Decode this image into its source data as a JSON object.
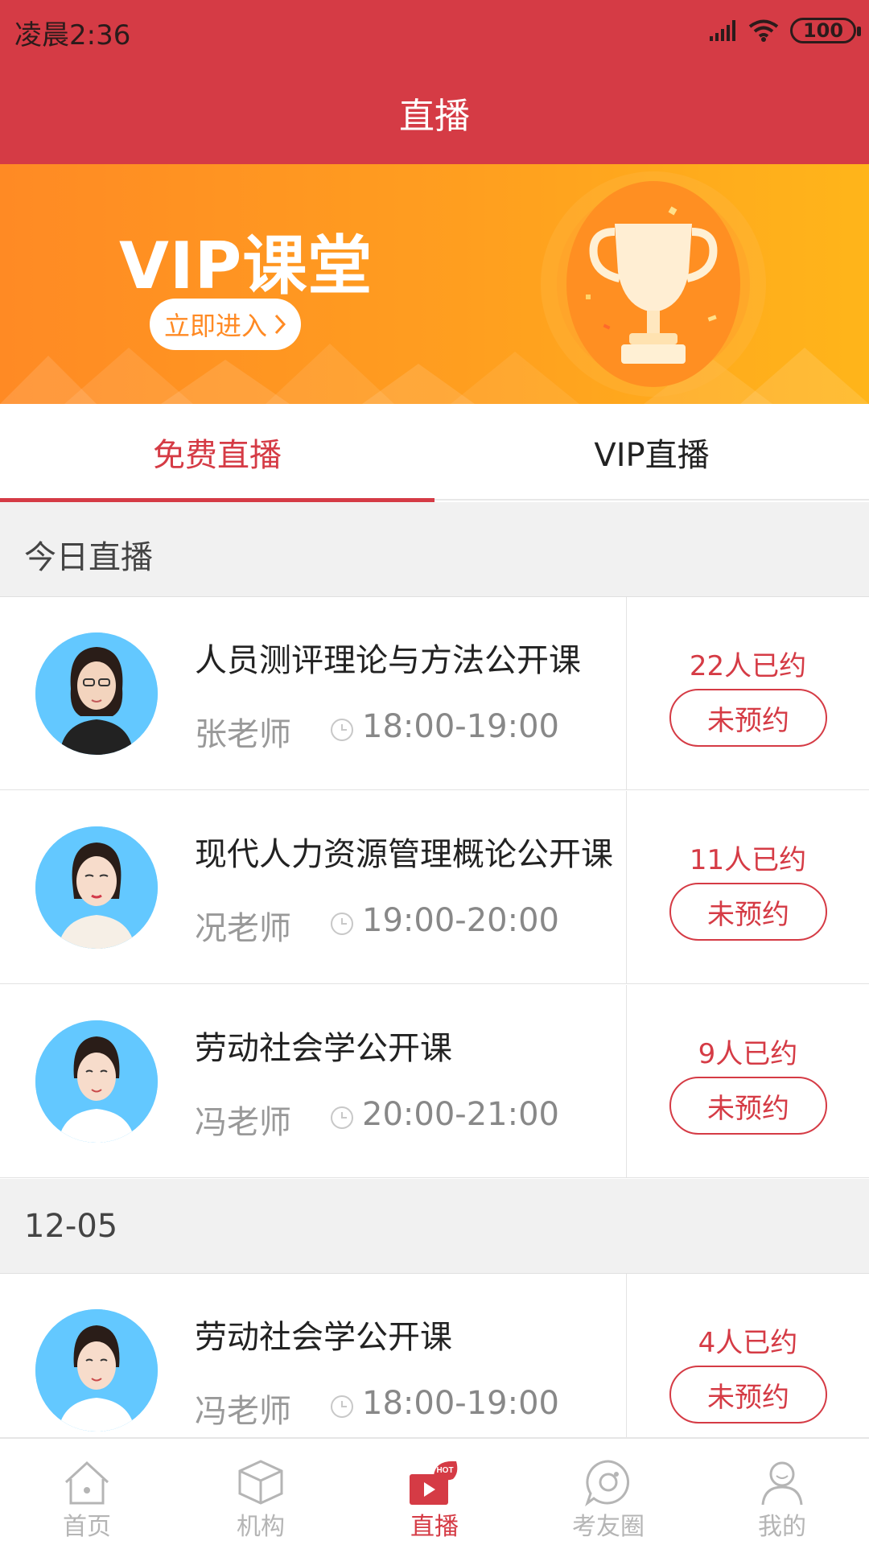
{
  "status_bar": {
    "time": "凌晨2:36",
    "battery": "100"
  },
  "header": {
    "title": "直播"
  },
  "banner": {
    "title": "VIP课堂",
    "button_label": "立即进入"
  },
  "tabs": [
    {
      "label": "免费直播",
      "active": true
    },
    {
      "label": "VIP直播",
      "active": false
    }
  ],
  "sections": [
    {
      "heading": "今日直播",
      "items": [
        {
          "course": "人员测评理论与方法公开课",
          "teacher": "张老师",
          "time": "18:00-19:00",
          "count": "22人已约",
          "button": "未预约"
        },
        {
          "course": "现代人力资源管理概论公开课",
          "teacher": "况老师",
          "time": "19:00-20:00",
          "count": "11人已约",
          "button": "未预约"
        },
        {
          "course": "劳动社会学公开课",
          "teacher": "冯老师",
          "time": "20:00-21:00",
          "count": "9人已约",
          "button": "未预约"
        }
      ]
    },
    {
      "heading": "12-05",
      "items": [
        {
          "course": "劳动社会学公开课",
          "teacher": "冯老师",
          "time": "18:00-19:00",
          "count": "4人已约",
          "button": "未预约"
        }
      ]
    }
  ],
  "bottom_nav": [
    {
      "label": "首页",
      "icon": "home-icon",
      "active": false
    },
    {
      "label": "机构",
      "icon": "cube-icon",
      "active": false
    },
    {
      "label": "直播",
      "icon": "live-hot-icon",
      "active": true,
      "badge": "HOT"
    },
    {
      "label": "考友圈",
      "icon": "chat-circle-icon",
      "active": false
    },
    {
      "label": "我的",
      "icon": "user-icon",
      "active": false
    }
  ],
  "colors": {
    "primary": "#d53b45",
    "banner_start": "#ff8a24",
    "banner_end": "#ffb51a",
    "avatar_bg": "#63c8ff"
  }
}
